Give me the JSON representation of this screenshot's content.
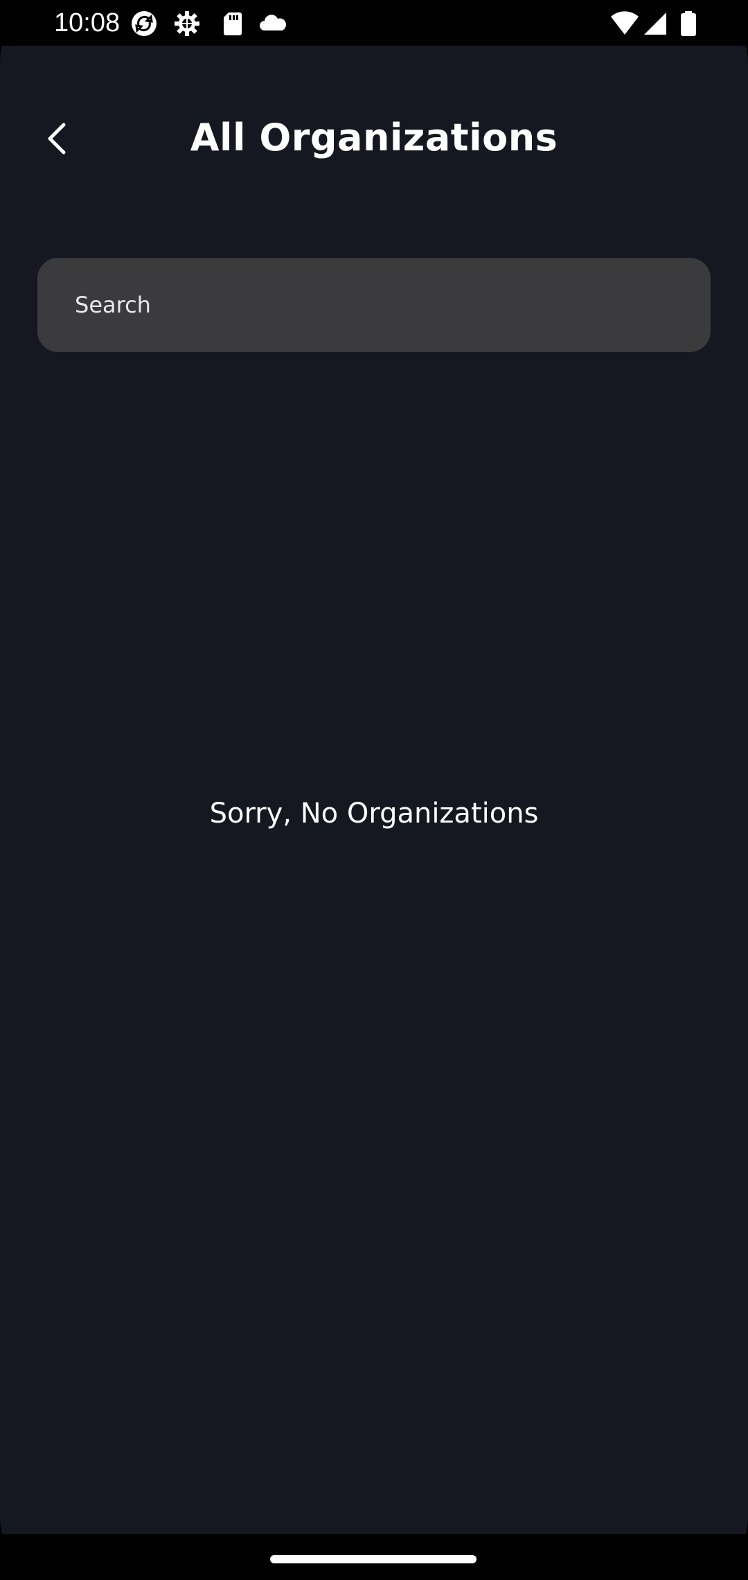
{
  "status_bar": {
    "time": "10:08",
    "icons": [
      "sync-icon",
      "settings-gear-icon",
      "sd-card-icon",
      "cloud-icon",
      "wifi-icon",
      "cellular-signal-icon",
      "battery-icon"
    ]
  },
  "header": {
    "back_icon": "chevron-left-icon",
    "title": "All Organizations"
  },
  "search": {
    "placeholder": "Search",
    "value": ""
  },
  "main": {
    "empty_message": "Sorry, No Organizations"
  },
  "colors": {
    "background": "#151821",
    "search_background": "#3b3b3e",
    "text": "#ffffff",
    "system_bars": "#000000"
  }
}
